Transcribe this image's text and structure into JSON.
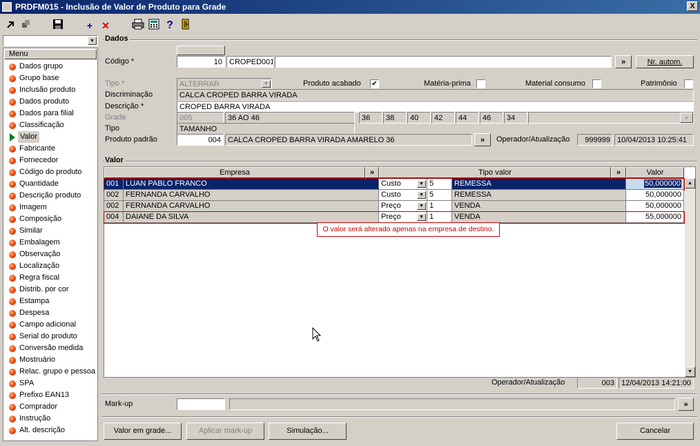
{
  "window": {
    "title": "PRDFM015 - Inclusão de Valor de Produto para Grade",
    "close": "X"
  },
  "toolbar": {
    "add": "+",
    "delete": "✕",
    "help": "?"
  },
  "sidebar": {
    "header": "Menu",
    "items": [
      "Dados grupo",
      "Grupo base",
      "Inclusão produto",
      "Dados produto",
      "Dados para filial",
      "Classificação",
      "Valor",
      "Fabricante",
      "Fornecedor",
      "Código do produto",
      "Quantidade",
      "Descrição produto",
      "Imagem",
      "Composição",
      "Similar",
      "Embalagem",
      "Observação",
      "Localização",
      "Regra fiscal",
      "Distrib. por cor",
      "Estampa",
      "Despesa",
      "Campo adicional",
      "Serial do produto",
      "Conversão medida",
      "Mostruário",
      "Relac. grupo e pessoa",
      "SPA",
      "Prefixo EAN13",
      "Comprador",
      "Instrução",
      "Alt. descrição"
    ],
    "active_index": 6
  },
  "dados": {
    "group_title": "Dados",
    "codigo_label": "Código *",
    "codigo_value": "10",
    "codigo_ref": "CROPED001",
    "more_btn": "»",
    "nr_autom_btn": "Nr. autom.",
    "tipo_label": "Tipo *",
    "tipo_value": "ALTERRAR",
    "produto_acabado_label": "Produto acabado",
    "materia_prima_label": "Matéria-prima",
    "material_consumo_label": "Material consumo",
    "patrimonio_label": "Patrimônio",
    "discriminacao_label": "Discriminação",
    "discriminacao_value": "CALCA CROPED BARRA VIRADA",
    "descricao_label": "Descrição *",
    "descricao_value": "CROPED BARRA VIRADA",
    "grade_label": "Grade",
    "grade_code": "005",
    "grade_desc": "36 AO 46",
    "grade_sizes": [
      "36",
      "38",
      "40",
      "42",
      "44",
      "46",
      "34"
    ],
    "tipo2_label": "Tipo",
    "tipo2_value": "TAMANHO",
    "produto_padrao_label": "Produto padrão",
    "produto_padrao_code": "004",
    "produto_padrao_desc": "CALCA CROPED BARRA VIRADA AMARELO 36",
    "operador_label": "Operador/Atualização",
    "operador_code": "999999",
    "operador_date": "10/04/2013 10:25:41"
  },
  "valor": {
    "group_title": "Valor",
    "columns": {
      "empresa": "Empresa",
      "tipo_valor": "Tipo valor",
      "valor": "Valor",
      "more": "»"
    },
    "rows": [
      {
        "code": "001",
        "empresa": "LUAN PABLO FRANCO",
        "tipo": "Custo",
        "num": "5",
        "tipo_desc": "REMESSA",
        "valor": "50,000000"
      },
      {
        "code": "002",
        "empresa": "FERNANDA CARVALHO",
        "tipo": "Custo",
        "num": "5",
        "tipo_desc": "REMESSA",
        "valor": "50,000000"
      },
      {
        "code": "002",
        "empresa": "FERNANDA CARVALHO",
        "tipo": "Preço",
        "num": "1",
        "tipo_desc": "VENDA",
        "valor": "50,000000"
      },
      {
        "code": "004",
        "empresa": "DAIANE DA SILVA",
        "tipo": "Preço",
        "num": "1",
        "tipo_desc": "VENDA",
        "valor": "55,000000"
      }
    ],
    "tooltip": "O valor será alterado apenas na empresa de destino.",
    "operador_label": "Operador/Atualização",
    "operador_code": "003",
    "operador_date": "12/04/2013 14:21:00"
  },
  "markup": {
    "label": "Mark-up",
    "value": "",
    "more": "»"
  },
  "buttons": {
    "valor_grade": "Valor em grade...",
    "aplicar_markup": "Aplicar mark-up",
    "simulacao": "Simulação...",
    "cancelar": "Cancelar"
  }
}
